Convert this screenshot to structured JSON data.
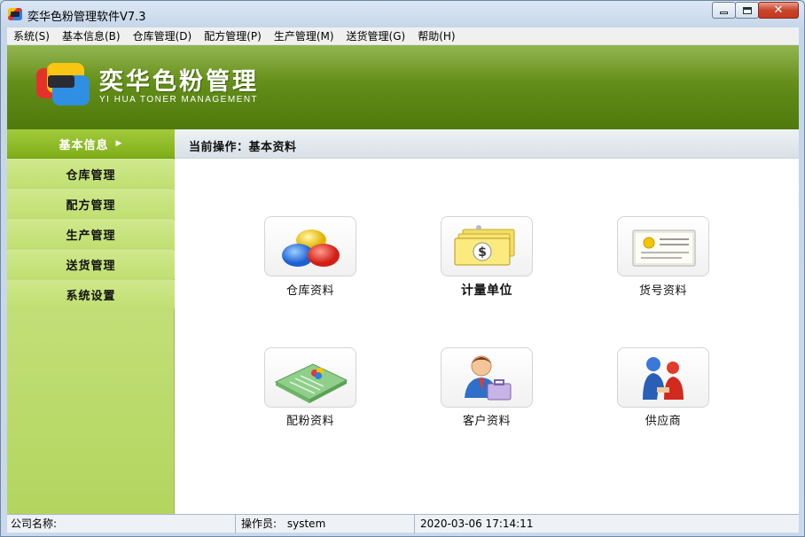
{
  "window": {
    "title": "奕华色粉管理软件V7.3"
  },
  "menu": [
    "系统(S)",
    "基本信息(B)",
    "仓库管理(D)",
    "配方管理(P)",
    "生产管理(M)",
    "送货管理(G)",
    "帮助(H)"
  ],
  "banner": {
    "title_cn": "奕华色粉管理",
    "title_en": "YI HUA TONER MANAGEMENT"
  },
  "sidebar": {
    "items": [
      {
        "label": "基本信息",
        "active": true
      },
      {
        "label": "仓库管理"
      },
      {
        "label": "配方管理"
      },
      {
        "label": "生产管理"
      },
      {
        "label": "送货管理"
      },
      {
        "label": "系统设置"
      }
    ]
  },
  "content": {
    "breadcrumb": "当前操作：基本资料",
    "tiles": [
      {
        "label": "仓库资料",
        "icon": "toner-balls-icon"
      },
      {
        "label": "计量单位",
        "icon": "money-bills-icon"
      },
      {
        "label": "货号资料",
        "icon": "label-card-icon"
      },
      {
        "label": "配粉资料",
        "icon": "color-folder-icon"
      },
      {
        "label": "客户资料",
        "icon": "customer-briefcase-icon"
      },
      {
        "label": "供应商",
        "icon": "supplier-people-icon"
      }
    ]
  },
  "status": {
    "company_label": "公司名称:",
    "operator_label": "操作员:",
    "operator": "system",
    "datetime": "2020-03-06 17:14:11"
  },
  "colors": {
    "banner_green": "#5f8a17",
    "sidebar_green": "#c4e07a",
    "active_item": "#8cb927"
  }
}
